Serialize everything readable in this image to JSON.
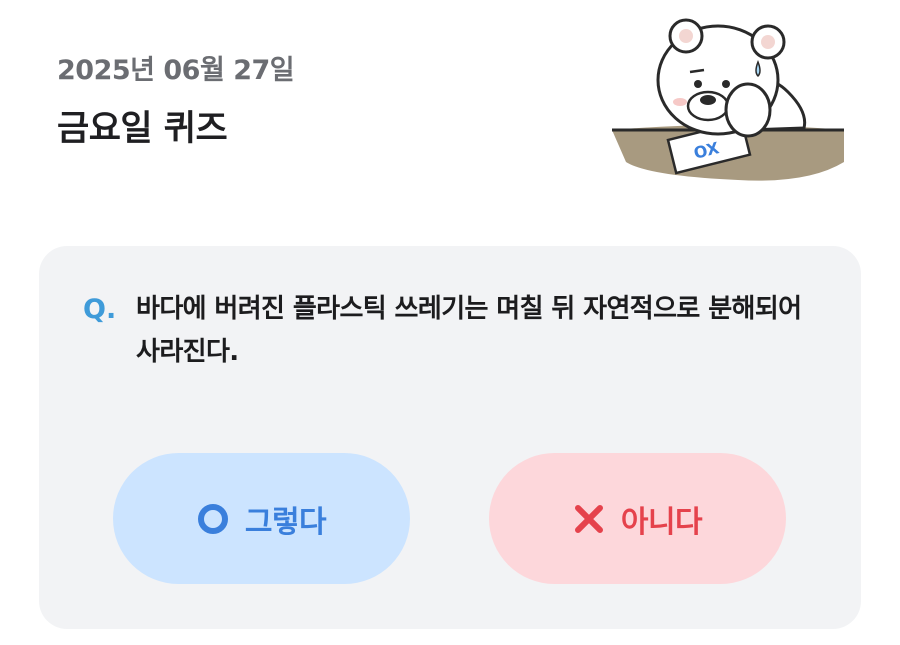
{
  "header": {
    "date": "2025년 06월 27일",
    "title": "금요일 퀴즈"
  },
  "mascot": {
    "icon": "polar-bear-thinking-icon",
    "card_text": "OX"
  },
  "quiz": {
    "q_label": "Q.",
    "question": "바다에 버려진 플라스틱 쓰레기는 며칠 뒤 자연적으로 분해되어 사라진다."
  },
  "answers": {
    "yes": {
      "label": "그렇다",
      "icon": "circle-o-icon",
      "color": "#3a7fdc",
      "background": "#cce4ff"
    },
    "no": {
      "label": "아니다",
      "icon": "x-mark-icon",
      "color": "#e5424c",
      "background": "#fdd7db"
    }
  }
}
